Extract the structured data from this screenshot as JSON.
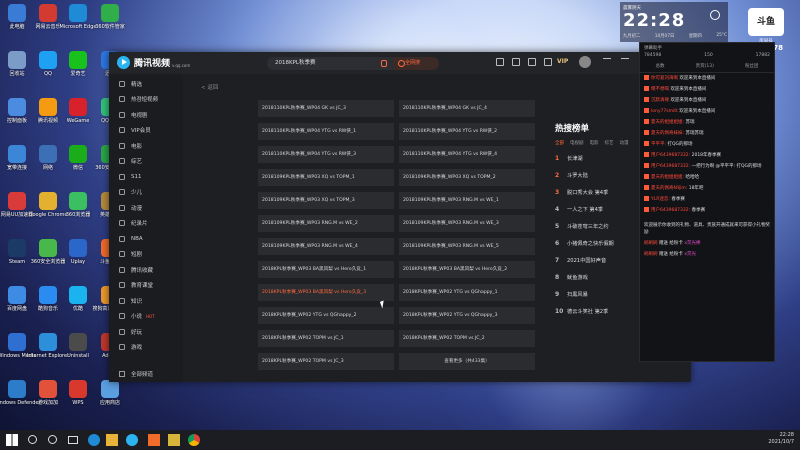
{
  "desktop": {
    "icons": [
      {
        "label": "此电脑",
        "color": "#3a7bd5"
      },
      {
        "label": "网易云音乐",
        "color": "#d33a31"
      },
      {
        "label": "Microsoft Edge",
        "color": "#1f8bd6"
      },
      {
        "label": "360软件管家",
        "color": "#2fae4a"
      },
      {
        "label": "回收站",
        "color": "#7a9cc6"
      },
      {
        "label": "QQ",
        "color": "#1ea1f2"
      },
      {
        "label": "爱奇艺",
        "color": "#19c11d"
      },
      {
        "label": "迅雷",
        "color": "#2c78e4"
      },
      {
        "label": "控制面板",
        "color": "#4b8be0"
      },
      {
        "label": "腾讯视频",
        "color": "#f49b12"
      },
      {
        "label": "WeGame",
        "color": "#d8222b"
      },
      {
        "label": "QQ音乐",
        "color": "#31c27c"
      },
      {
        "label": "宽带连接",
        "color": "#3b86d6"
      },
      {
        "label": "网络",
        "color": "#3c6fb4"
      },
      {
        "label": "微信",
        "color": "#1aad19"
      },
      {
        "label": "360安全卫士",
        "color": "#2aa748"
      },
      {
        "label": "网易UU加速器",
        "color": "#d93b3b"
      },
      {
        "label": "Google Chrome",
        "color": "#e3b12f"
      },
      {
        "label": "360浏览器",
        "color": "#3bbf61"
      },
      {
        "label": "英雄联盟",
        "color": "#b78b3c"
      },
      {
        "label": "Steam",
        "color": "#1b3b66"
      },
      {
        "label": "360安全浏览器",
        "color": "#49b84a"
      },
      {
        "label": "Uplay",
        "color": "#2b66c9"
      },
      {
        "label": "斗鱼直播",
        "color": "#f26b2b"
      },
      {
        "label": "百度网盘",
        "color": "#3d8be3"
      },
      {
        "label": "酷狗音乐",
        "color": "#2a8cf0"
      },
      {
        "label": "优酷",
        "color": "#1bb3ef"
      },
      {
        "label": "搜狗高速浏览器",
        "color": "#f19a2b"
      },
      {
        "label": "Windows Media",
        "color": "#2f6fd1"
      },
      {
        "label": "Internet Explorer",
        "color": "#2d8fd9"
      },
      {
        "label": "Uninstall",
        "color": "#4b4b4b"
      },
      {
        "label": "Adobe",
        "color": "#c4372c"
      },
      {
        "label": "Windows Defender",
        "color": "#2c7cc9"
      },
      {
        "label": "游戏加加",
        "color": "#e2513a"
      },
      {
        "label": "WPS",
        "color": "#d9392d"
      },
      {
        "label": "应用商店",
        "color": "#5a9fe0"
      }
    ]
  },
  "app": {
    "logo_text": "腾讯视频",
    "logo_sub": "v.qq.com",
    "search": {
      "value": "2018KPL秋季赛",
      "button": "全网搜"
    },
    "vip_label": "VIP",
    "back_label": "< 返回",
    "sidebar": [
      {
        "label": "精选"
      },
      {
        "label": "热점短视频"
      },
      {
        "label": "电视剧"
      },
      {
        "label": "VIP会员"
      },
      {
        "label": "电影"
      },
      {
        "label": "综艺"
      },
      {
        "label": "S11"
      },
      {
        "label": "少儿"
      },
      {
        "label": "动漫"
      },
      {
        "label": "纪录片"
      },
      {
        "label": "NBA"
      },
      {
        "label": "短剧"
      },
      {
        "label": "腾讯收藏"
      },
      {
        "label": "教育课堂"
      },
      {
        "label": "知识"
      },
      {
        "label": "小说",
        "badge": "HOT"
      },
      {
        "label": "好玩"
      },
      {
        "label": "游戏"
      }
    ],
    "sidebar_footer": "全部频道",
    "episodes": [
      "2018110KPL秋季赛_WP04 GK vs JC_3",
      "2018110KPL秋季赛_WP04 GK vs JC_4",
      "2018110KPL秋季赛_WP04 YTG vs RW侠_1",
      "2018110KPL秋季赛_WP04 YTG vs RW侠_2",
      "2018110KPL秋季赛_WP04 YTG vs RW侠_3",
      "2018110KPL秋季赛_WP04 YTG vs RW侠_4",
      "2018109KPL秋季赛_WP03 XQ vs TOPM_1",
      "2018109KPL秋季赛_WP03 XQ vs TOPM_2",
      "2018109KPL秋季赛_WP03 XQ vs TOPM_3",
      "2018109KPL秋季赛_WP03 RNG.M vs WE_1",
      "2018109KPL秋季赛_WP03 RNG.M vs WE_2",
      "2018109KPL秋季赛_WP03 RNG.M vs WE_3",
      "2018109KPL秋季赛_WP03 RNG.M vs WE_4",
      "2018109KPL秋季赛_WP03 RNG.M vs WE_5",
      "2018KPL秋季赛_WP03 BA黑凤梨 vs Hero久竞_1",
      "2018KPL秋季赛_WP03 BA黑凤梨 vs Hero久竞_2",
      "2018KPL秋季赛_WP03 BA黑凤梨 vs Hero久竞_3",
      "2018KPL秋季赛_WP02 YTG vs QGhappy_1",
      "2018KPL秋季赛_WP02 YTG vs QGhappy_2",
      "2018KPL秋季赛_WP02 YTG vs QGhappy_3",
      "2018KPL秋季赛_WP02 TOPM vs JC_1",
      "2018KPL秋季赛_WP02 TOPM vs JC_2",
      "2018KPL秋季赛_WP02 TOPM vs JC_3"
    ],
    "active_episode": 16,
    "more_label": "查看更多（共433集）",
    "hot": {
      "title": "热搜榜单",
      "tabs": [
        "全部",
        "电视剧",
        "电影",
        "综艺",
        "动漫"
      ],
      "items": [
        "长津湖",
        "斗罗大陆",
        "脱口秀大会 第4季",
        "一人之下 第4季",
        "斗破苍穹三年之约",
        "小猪佩奇之快乐假期",
        "2021中国好声音",
        "鱿鱼游戏",
        "扫黑风暴",
        "德云斗笑社 第2季"
      ]
    }
  },
  "clock": {
    "top_line": "晨雾阴天",
    "time": "22:28",
    "date_left": "九月初二",
    "date_mid": "10月07日",
    "date_right": "星期四",
    "weather": "25°C"
  },
  "stream": {
    "brand": "斗鱼",
    "room_label": "房间号",
    "room_number": "9606778",
    "header": "弹幕助手",
    "stats": [
      "784598",
      "150",
      "17882"
    ],
    "tabs": [
      "总数",
      "贵宾(13)",
      "粉丝团"
    ],
    "messages": [
      {
        "name": "你可爱刘海啊",
        "text": "欢迎来到本直播间"
      },
      {
        "name": "俺不想喝",
        "text": "欢迎来到本直播间"
      },
      {
        "name": "沉默滴辣",
        "text": "欢迎来到本直播间"
      },
      {
        "name": "lony77smitt",
        "text": "欢迎来到本直播间"
      },
      {
        "name": "夏天的姐姐姐姐:",
        "text": "苏瑞"
      },
      {
        "name": "夏天的佩奇妹妹:",
        "text": "苏瑞苏瑞"
      },
      {
        "name": "平平平:",
        "text": "打QG的那场"
      },
      {
        "name": "用户6439687332:",
        "text": "2018年春季赛"
      },
      {
        "name": "用户6439687332:",
        "text": "一把行为啊 @平平平: 打QG的那场"
      },
      {
        "name": "夏天的姐姐姐姐:",
        "text": "哈哈哈"
      },
      {
        "name": "夏天的佩奇N号m:",
        "text": "18年吧"
      },
      {
        "name": "YLR迷恋:",
        "text": "春季赛"
      },
      {
        "name": "用户6439687332:",
        "text": "春季赛"
      }
    ],
    "notice": "欢迎展示你收到的礼物、道具、贵族开通成就来可获得小礼物奖励",
    "gifts": [
      {
        "name": "刷刷刷",
        "text": "赠送 给粉卡",
        "gift": "x荧光棒"
      },
      {
        "name": "刷刷刷",
        "text": "赠送 给粉卡",
        "gift": "x荧光"
      }
    ]
  },
  "taskbar": {
    "time": "22:28",
    "date": "2021/10/7"
  }
}
